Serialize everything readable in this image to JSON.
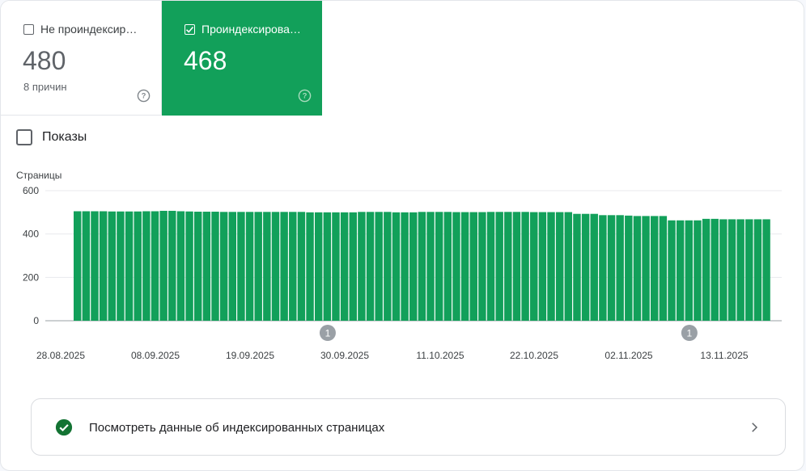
{
  "tiles": {
    "not_indexed": {
      "label": "Не проиндексир…",
      "value": "480",
      "sub": "8 причин",
      "checked": false
    },
    "indexed": {
      "label": "Проиндексирова…",
      "value": "468",
      "checked": true,
      "color": "#12a05a"
    }
  },
  "impressions": {
    "label": "Показы",
    "checked": false
  },
  "chart_data": {
    "type": "bar",
    "ylabel": "Страницы",
    "ylim": [
      0,
      600
    ],
    "yticks": [
      0,
      200,
      400,
      600
    ],
    "bar_color": "#12a05a",
    "grid": true,
    "xtick_labels": [
      "28.08.2025",
      "08.09.2025",
      "19.09.2025",
      "30.09.2025",
      "11.10.2025",
      "22.10.2025",
      "02.11.2025",
      "13.11.2025"
    ],
    "start_date": "2025-08-31",
    "values": [
      505,
      505,
      505,
      505,
      504,
      504,
      504,
      504,
      505,
      505,
      507,
      507,
      505,
      504,
      503,
      503,
      503,
      502,
      502,
      502,
      502,
      502,
      502,
      502,
      502,
      502,
      502,
      500,
      500,
      500,
      500,
      500,
      500,
      502,
      502,
      502,
      502,
      500,
      500,
      500,
      502,
      502,
      502,
      502,
      501,
      501,
      501,
      501,
      502,
      502,
      502,
      502,
      502,
      501,
      501,
      501,
      501,
      501,
      493,
      493,
      493,
      487,
      487,
      487,
      485,
      483,
      483,
      483,
      483,
      463,
      463,
      463,
      463,
      470,
      470,
      468,
      468,
      468,
      468,
      468,
      468
    ],
    "annotations": [
      {
        "date": "2025-09-29",
        "label": "1"
      },
      {
        "date": "2025-11-10",
        "label": "1"
      }
    ]
  },
  "link": {
    "text": "Посмотреть данные об индексированных страницах"
  }
}
